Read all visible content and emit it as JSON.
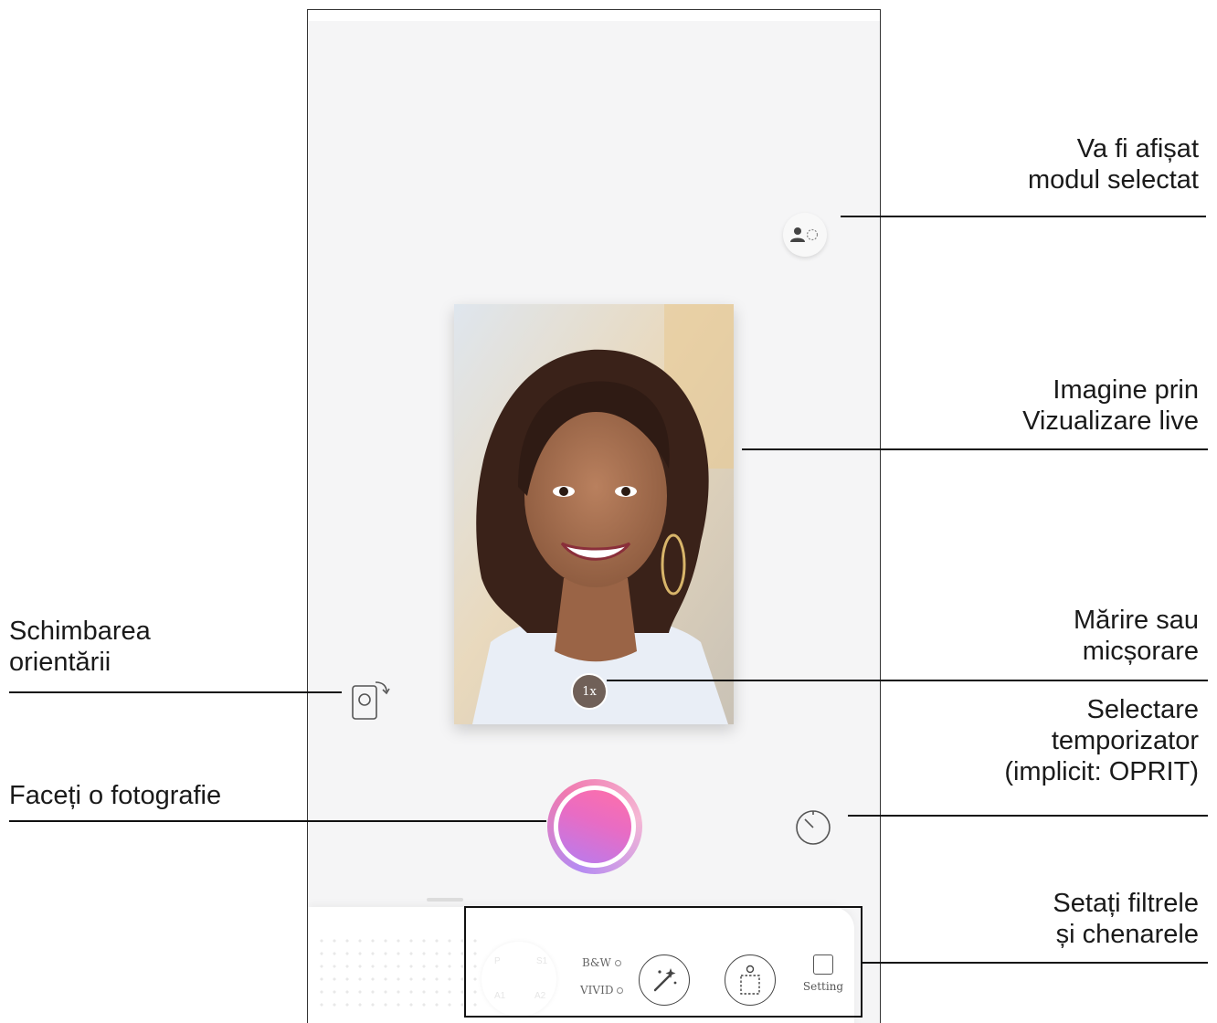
{
  "annotations": {
    "mode_selected": [
      "Va fi afișat",
      "modul selectat"
    ],
    "live_view": [
      "Imagine prin",
      "Vizualizare live"
    ],
    "zoom": [
      "Mărire sau",
      "micșorare"
    ],
    "timer": [
      "Selectare",
      "temporizator",
      "(implicit: OPRIT)"
    ],
    "filters_frames": [
      "Setați filtrele",
      "și chenarele"
    ],
    "orientation": [
      "Schimbarea",
      "orientării"
    ],
    "take_photo": [
      "Faceți o fotografie"
    ]
  },
  "camera": {
    "zoom_label": "1x",
    "filter_options": [
      "B&W",
      "VIVID"
    ],
    "setting_label": "Setting"
  },
  "colors": {
    "shutter_gradient": [
      "#ff6fa8",
      "#b67cf0"
    ],
    "screen_bg": "#f5f5f6"
  }
}
